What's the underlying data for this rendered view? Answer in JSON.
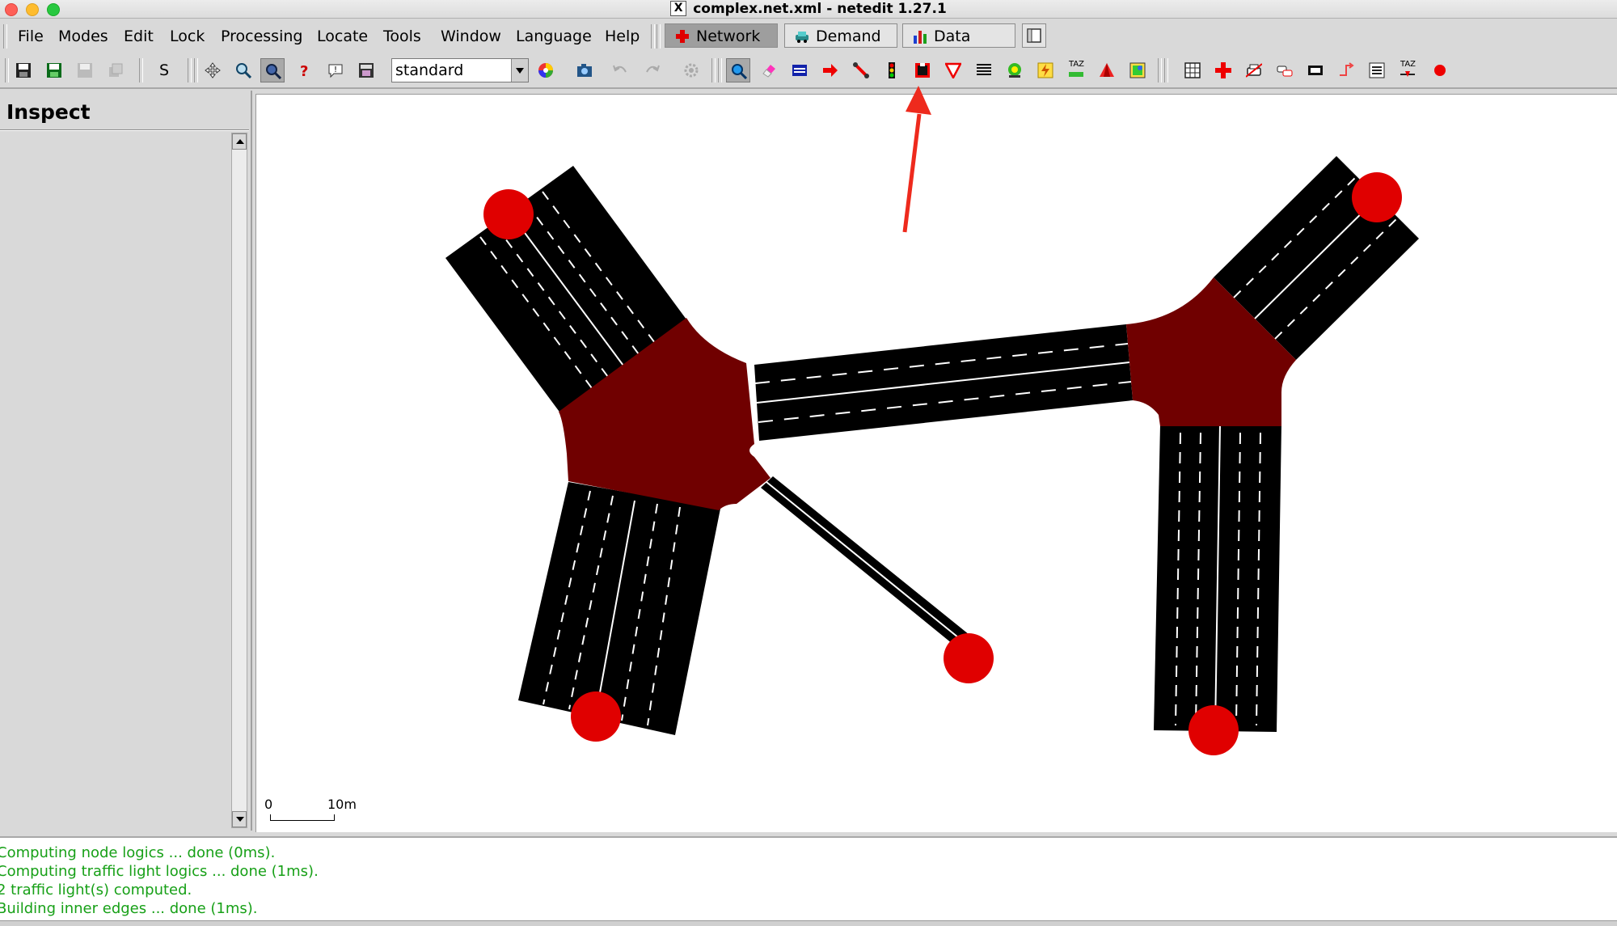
{
  "window": {
    "title": "complex.net.xml - netedit 1.27.1",
    "x_icon": "X"
  },
  "menu": [
    {
      "label": "File"
    },
    {
      "label": "Modes"
    },
    {
      "label": "Edit"
    },
    {
      "label": "Lock"
    },
    {
      "label": "Processing"
    },
    {
      "label": "Locate"
    },
    {
      "label": "Tools"
    },
    {
      "label": "Window"
    },
    {
      "label": "Language"
    },
    {
      "label": "Help"
    }
  ],
  "modes": {
    "network": "Network",
    "demand": "Demand",
    "data": "Data"
  },
  "toolbar": {
    "s_label": "S",
    "scheme_value": "standard",
    "taz_label": "TAZ",
    "taz2_label": "TAZ"
  },
  "inspect": {
    "title": "Inspect"
  },
  "scale": {
    "zero": "0",
    "ten": "10m"
  },
  "messages": [
    "Computing node logics ... done (0ms).",
    "Computing traffic light logics ... done (1ms).",
    "2 traffic light(s) computed.",
    "Building inner edges ... done (1ms)."
  ],
  "colors": {
    "junction": "#700000",
    "road": "#000000",
    "node": "#e00000",
    "arrow": "#ee2a1d",
    "message": "#17a017"
  }
}
